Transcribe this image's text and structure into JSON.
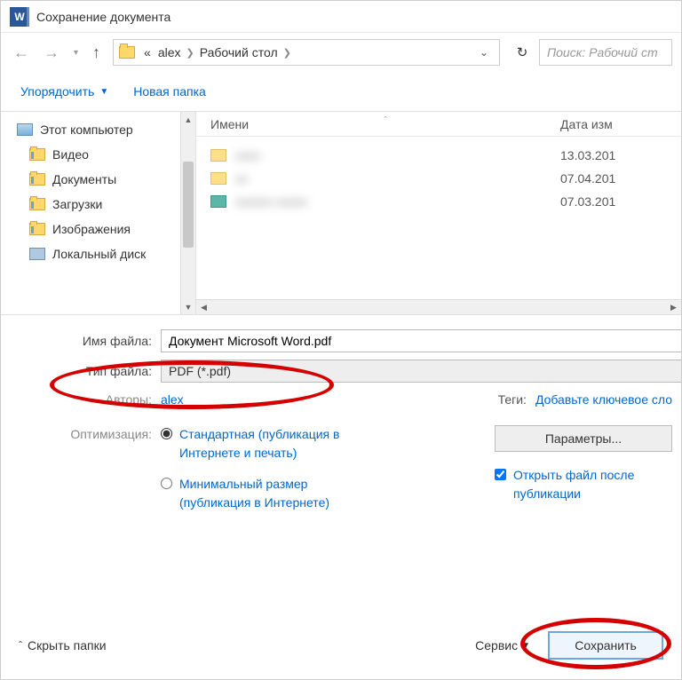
{
  "window": {
    "title": "Сохранение документа"
  },
  "breadcrumb": {
    "prefix": "«",
    "parts": [
      "alex",
      "Рабочий стол"
    ]
  },
  "search": {
    "placeholder": "Поиск: Рабочий ст"
  },
  "toolbar": {
    "organize": "Упорядочить",
    "new_folder": "Новая папка"
  },
  "sidebar": {
    "items": [
      {
        "label": "Этот компьютер",
        "icon": "pc",
        "root": true
      },
      {
        "label": "Видео",
        "icon": "folder"
      },
      {
        "label": "Документы",
        "icon": "folder"
      },
      {
        "label": "Загрузки",
        "icon": "folder"
      },
      {
        "label": "Изображения",
        "icon": "folder"
      },
      {
        "label": "Локальный диск",
        "icon": "disk"
      }
    ]
  },
  "columns": {
    "name": "Имени",
    "date": "Дата изм"
  },
  "files": [
    {
      "name": "xxxx",
      "date": "13.03.201",
      "icon": "fldr"
    },
    {
      "name": "xx",
      "date": "07.04.201",
      "icon": "fldr"
    },
    {
      "name": "xxxxxx xxxxx",
      "date": "07.03.201",
      "icon": "img"
    }
  ],
  "form": {
    "filename_label": "Имя файла:",
    "filename_value": "Документ Microsoft Word.pdf",
    "filetype_label": "Тип файла:",
    "filetype_value": "PDF (*.pdf)",
    "authors_label": "Авторы:",
    "authors_value": "alex",
    "tags_label": "Теги:",
    "tags_value": "Добавьте ключевое сло"
  },
  "optimize": {
    "label": "Оптимизация:",
    "standard": "Стандартная (публикация в Интернете и печать)",
    "minimal": "Минимальный размер (публикация в Интернете)",
    "params_btn": "Параметры...",
    "open_after": "Открыть файл после публикации"
  },
  "footer": {
    "hide_folders": "Скрыть папки",
    "tools": "Сервис",
    "save": "Сохранить"
  }
}
